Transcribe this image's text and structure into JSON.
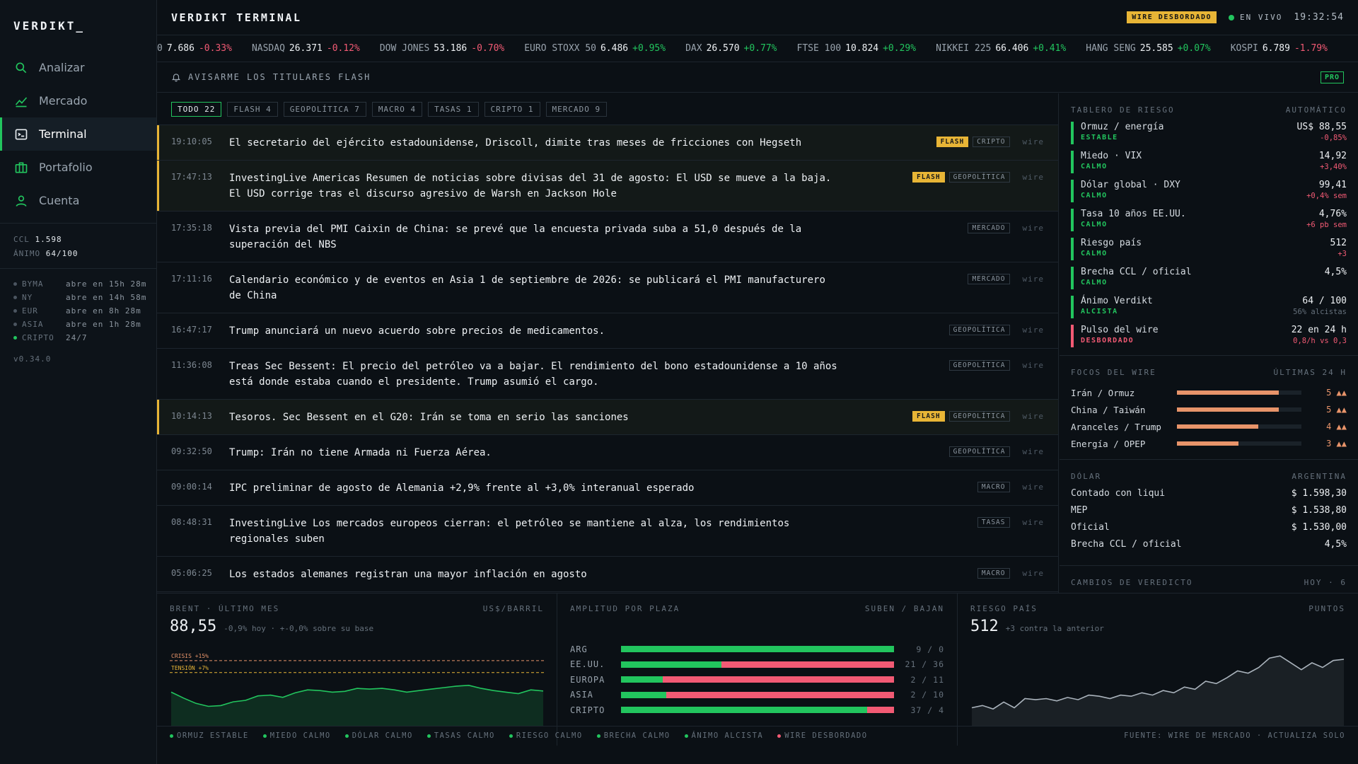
{
  "brand": "VERDIKT_",
  "nav": [
    {
      "label": "Analizar",
      "icon": "search-icon"
    },
    {
      "label": "Mercado",
      "icon": "chart-line-icon"
    },
    {
      "label": "Terminal",
      "icon": "terminal-icon"
    },
    {
      "label": "Portafolio",
      "icon": "briefcase-icon"
    },
    {
      "label": "Cuenta",
      "icon": "user-icon"
    }
  ],
  "side_metrics": {
    "ccl_label": "CCL",
    "ccl_value": "1.598",
    "animo_label": "ÁNIMO",
    "animo_value": "64/100"
  },
  "markets": [
    {
      "name": "BYMA",
      "status": "abre en 15h 28m",
      "open": false
    },
    {
      "name": "NY",
      "status": "abre en 14h 58m",
      "open": false
    },
    {
      "name": "EUR",
      "status": "abre en 8h 28m",
      "open": false
    },
    {
      "name": "ASIA",
      "status": "abre en 1h 28m",
      "open": false
    },
    {
      "name": "CRIPTO",
      "status": "24/7",
      "open": true
    }
  ],
  "version": "v0.34.0",
  "header": {
    "title": "VERDIKT TERMINAL",
    "wire_badge": "WIRE DESBORDADO",
    "live": "EN VIVO",
    "clock": "19:32:54"
  },
  "ticker": [
    {
      "name": "0",
      "price": "7.686",
      "change": "-0.33%",
      "dir": "dn"
    },
    {
      "name": "NASDAQ",
      "price": "26.371",
      "change": "-0.12%",
      "dir": "dn"
    },
    {
      "name": "DOW JONES",
      "price": "53.186",
      "change": "-0.70%",
      "dir": "dn"
    },
    {
      "name": "EURO STOXX 50",
      "price": "6.486",
      "change": "+0.95%",
      "dir": "up"
    },
    {
      "name": "DAX",
      "price": "26.570",
      "change": "+0.77%",
      "dir": "up"
    },
    {
      "name": "FTSE 100",
      "price": "10.824",
      "change": "+0.29%",
      "dir": "up"
    },
    {
      "name": "NIKKEI 225",
      "price": "66.406",
      "change": "+0.41%",
      "dir": "up"
    },
    {
      "name": "HANG SENG",
      "price": "25.585",
      "change": "+0.07%",
      "dir": "up"
    },
    {
      "name": "KOSPI",
      "price": "6.789",
      "change": "-1.79%",
      "dir": "dn"
    }
  ],
  "alert": {
    "label": "AVISARME LOS TITULARES FLASH",
    "pro": "PRO"
  },
  "filters": [
    {
      "label": "TODO 22",
      "active": true
    },
    {
      "label": "FLASH 4",
      "active": false
    },
    {
      "label": "GEOPOLÍTICA 7",
      "active": false
    },
    {
      "label": "MACRO 4",
      "active": false
    },
    {
      "label": "TASAS 1",
      "active": false
    },
    {
      "label": "CRIPTO 1",
      "active": false
    },
    {
      "label": "MERCADO 9",
      "active": false
    }
  ],
  "feed": [
    {
      "time": "19:10:05",
      "headline": "El secretario del ejército estadounidense, Driscoll, dimite tras meses de fricciones con Hegseth",
      "flash": true,
      "flash_label": "FLASH",
      "tag": "CRIPTO",
      "source": "wire"
    },
    {
      "time": "17:47:13",
      "headline": "InvestingLive Americas Resumen de noticias sobre divisas del 31 de agosto: El USD se mueve a la baja. El USD corrige tras el discurso agresivo de Warsh en Jackson Hole",
      "flash": true,
      "flash_label": "FLASH",
      "tag": "GEOPOLÍTICA",
      "source": "wire"
    },
    {
      "time": "17:35:18",
      "headline": "Vista previa del PMI Caixin de China: se prevé que la encuesta privada suba a 51,0 después de la superación del NBS",
      "flash": false,
      "flash_label": "",
      "tag": "MERCADO",
      "source": "wire"
    },
    {
      "time": "17:11:16",
      "headline": "Calendario económico y de eventos en Asia 1 de septiembre de 2026: se publicará el PMI manufacturero de China",
      "flash": false,
      "flash_label": "",
      "tag": "MERCADO",
      "source": "wire"
    },
    {
      "time": "16:47:17",
      "headline": "Trump anunciará un nuevo acuerdo sobre precios de medicamentos.",
      "flash": false,
      "flash_label": "",
      "tag": "GEOPOLÍTICA",
      "source": "wire"
    },
    {
      "time": "11:36:08",
      "headline": "Treas Sec Bessent: El precio del petróleo va a bajar. El rendimiento del bono estadounidense a 10 años está donde estaba cuando el presidente. Trump asumió el cargo.",
      "flash": false,
      "flash_label": "",
      "tag": "GEOPOLÍTICA",
      "source": "wire"
    },
    {
      "time": "10:14:13",
      "headline": "Tesoros. Sec Bessent en el G20: Irán se toma en serio las sanciones",
      "flash": true,
      "flash_label": "FLASH",
      "tag": "GEOPOLÍTICA",
      "source": "wire"
    },
    {
      "time": "09:32:50",
      "headline": "Trump: Irán no tiene Armada ni Fuerza Aérea.",
      "flash": false,
      "flash_label": "",
      "tag": "GEOPOLÍTICA",
      "source": "wire"
    },
    {
      "time": "09:00:14",
      "headline": "IPC preliminar de agosto de Alemania +2,9% frente al +3,0% interanual esperado",
      "flash": false,
      "flash_label": "",
      "tag": "MACRO",
      "source": "wire"
    },
    {
      "time": "08:48:31",
      "headline": "InvestingLive Los mercados europeos cierran: el petróleo se mantiene al alza, los rendimientos regionales suben",
      "flash": false,
      "flash_label": "",
      "tag": "TASAS",
      "source": "wire"
    },
    {
      "time": "05:06:25",
      "headline": "Los estados alemanes registran una mayor inflación en agosto",
      "flash": false,
      "flash_label": "",
      "tag": "MACRO",
      "source": "wire"
    }
  ],
  "risk_board": {
    "title": "TABLERO DE RIESGO",
    "mode": "AUTOMÁTICO",
    "items": [
      {
        "name": "Ormuz / energía",
        "status": "ESTABLE",
        "value": "US$ 88,55",
        "delta": "-0,85%",
        "dir": "dn",
        "bad": false
      },
      {
        "name": "Miedo · VIX",
        "status": "CALMO",
        "value": "14,92",
        "delta": "+3,40%",
        "dir": "dn",
        "bad": false
      },
      {
        "name": "Dólar global · DXY",
        "status": "CALMO",
        "value": "99,41",
        "delta": "+0,4% sem",
        "dir": "dn",
        "bad": false
      },
      {
        "name": "Tasa 10 años EE.UU.",
        "status": "CALMO",
        "value": "4,76%",
        "delta": "+6 pb sem",
        "dir": "dn",
        "bad": false
      },
      {
        "name": "Riesgo país",
        "status": "CALMO",
        "value": "512",
        "delta": "+3",
        "dir": "dn",
        "bad": false
      },
      {
        "name": "Brecha CCL / oficial",
        "status": "CALMO",
        "value": "4,5%",
        "delta": "",
        "dir": "dn",
        "bad": false
      },
      {
        "name": "Ánimo Verdikt",
        "status": "ALCISTA",
        "value": "64 / 100",
        "delta": "56% alcistas",
        "dir": "mute",
        "bad": false
      },
      {
        "name": "Pulso del wire",
        "status": "DESBORDADO",
        "value": "22 en 24 h",
        "delta": "0,8/h vs 0,3",
        "dir": "dn",
        "bad": true
      }
    ]
  },
  "focus": {
    "title": "FOCOS DEL WIRE",
    "range": "ÚLTIMAS 24 H",
    "items": [
      {
        "name": "Irán / Ormuz",
        "count": "5 ▲▲",
        "level": 1.0
      },
      {
        "name": "China / Taiwán",
        "count": "5 ▲▲",
        "level": 1.0
      },
      {
        "name": "Aranceles / Trump",
        "count": "4 ▲▲",
        "level": 0.8
      },
      {
        "name": "Energía / OPEP",
        "count": "3 ▲▲",
        "level": 0.6
      }
    ]
  },
  "dolar": {
    "title": "DÓLAR",
    "region": "ARGENTINA",
    "items": [
      {
        "name": "Contado con liqui",
        "value": "$ 1.598,30"
      },
      {
        "name": "MEP",
        "value": "$ 1.538,80"
      },
      {
        "name": "Oficial",
        "value": "$ 1.530,00"
      },
      {
        "name": "Brecha CCL / oficial",
        "value": "4,5%"
      }
    ]
  },
  "cambios": {
    "title": "CAMBIOS DE VEREDICTO",
    "range": "HOY · 6"
  },
  "brent": {
    "title": "BRENT · ÚLTIMO MES",
    "unit": "US$/BARRIL",
    "value": "88,55",
    "sub": "-0,9% hoy · +-0,0% sobre su base",
    "crisis_label": "CRISIS +15%",
    "tension_label": "TENSIÓN +7%"
  },
  "amplitud": {
    "title": "AMPLITUD POR PLAZA",
    "legend": "SUBEN / BAJAN",
    "rows": [
      {
        "name": "ARG",
        "up": 9,
        "down": 0,
        "label": "9 / 0"
      },
      {
        "name": "EE.UU.",
        "up": 21,
        "down": 36,
        "label": "21 / 36"
      },
      {
        "name": "EUROPA",
        "up": 2,
        "down": 11,
        "label": "2 / 11"
      },
      {
        "name": "ASIA",
        "up": 2,
        "down": 10,
        "label": "2 / 10"
      },
      {
        "name": "CRIPTO",
        "up": 37,
        "down": 4,
        "label": "37 / 4"
      }
    ]
  },
  "riesgo": {
    "title": "RIESGO PAÍS",
    "unit": "PUNTOS",
    "value": "512",
    "sub": "+3 contra la anterior"
  },
  "chart_data": [
    {
      "type": "area",
      "title": "BRENT · ÚLTIMO MES",
      "ylabel": "US$/BARRIL",
      "values": [
        88.4,
        87.6,
        86.9,
        86.5,
        86.6,
        87.1,
        87.3,
        87.9,
        88.0,
        87.7,
        88.3,
        88.7,
        88.6,
        88.4,
        88.5,
        88.9,
        88.8,
        88.9,
        88.7,
        88.4,
        88.6,
        88.8,
        89.0,
        89.2,
        89.3,
        88.9,
        88.6,
        88.4,
        88.2,
        88.7,
        88.55
      ],
      "ylim": [
        84,
        94
      ],
      "lines": [
        {
          "label": "CRISIS +15%",
          "value": 92.6
        },
        {
          "label": "TENSIÓN +7%",
          "value": 91.0
        }
      ]
    },
    {
      "type": "area",
      "title": "RIESGO PAÍS",
      "ylabel": "PUNTOS",
      "values": [
        470,
        472,
        469,
        475,
        470,
        478,
        477,
        478,
        476,
        479,
        477,
        481,
        480,
        478,
        481,
        480,
        483,
        481,
        485,
        483,
        488,
        486,
        493,
        491,
        496,
        502,
        500,
        505,
        513,
        515,
        509,
        503,
        509,
        505,
        511,
        512
      ],
      "ylim": [
        455,
        520
      ]
    }
  ],
  "status": [
    {
      "label": "ORMUZ ESTABLE",
      "bad": false
    },
    {
      "label": "MIEDO CALMO",
      "bad": false
    },
    {
      "label": "DÓLAR CALMO",
      "bad": false
    },
    {
      "label": "TASAS CALMO",
      "bad": false
    },
    {
      "label": "RIESGO CALMO",
      "bad": false
    },
    {
      "label": "BRECHA CALMO",
      "bad": false
    },
    {
      "label": "ÁNIMO ALCISTA",
      "bad": false
    },
    {
      "label": "WIRE DESBORDADO",
      "bad": true
    }
  ],
  "footer_source": "FUENTE: WIRE DE MERCADO · ACTUALIZA SOLO"
}
